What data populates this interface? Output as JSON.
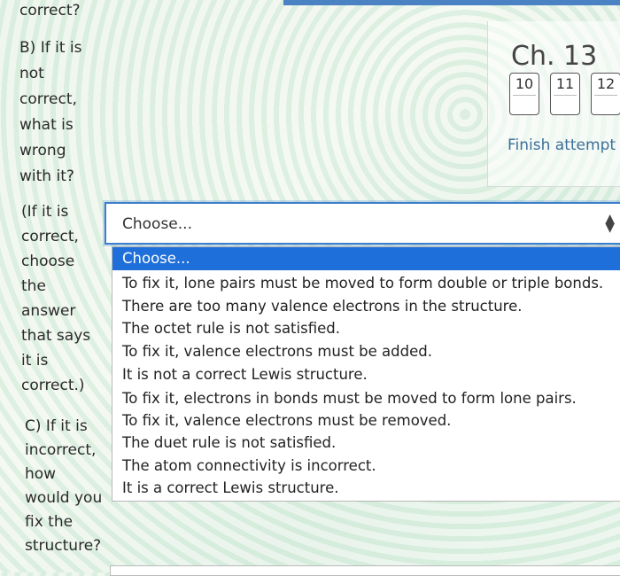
{
  "question": {
    "top_fragment": "correct?",
    "part_b_lines": [
      "B) If it is",
      "not",
      "correct,",
      "what is",
      "wrong",
      "with it?"
    ],
    "hint_lines": [
      "(If it is",
      "correct,",
      "choose",
      "the",
      "answer",
      "that says",
      "it is",
      "correct.)"
    ],
    "part_c_lines": [
      "C) If it is",
      "incorrect,",
      "how",
      "would you",
      "fix the",
      "structure?"
    ]
  },
  "navigation": {
    "chapter_title": "Ch. 13",
    "question_buttons": [
      "10",
      "11",
      "12"
    ],
    "finish_link": "Finish attempt ..."
  },
  "select": {
    "current_value": "Choose...",
    "options": [
      "Choose...",
      "To fix it, lone pairs must be moved to form double or triple bonds.",
      "There are too many valence electrons in the structure.",
      "The octet rule is not satisfied.",
      "To fix it, valence electrons must be added.",
      "It is not a correct Lewis structure.",
      "To fix it, electrons in bonds must be moved to form lone pairs.",
      "To fix it, valence electrons must be removed.",
      "The duet rule is not satisfied.",
      "The atom connectivity is incorrect.",
      "It is a correct Lewis structure."
    ],
    "selected_index": 0,
    "arrow_icon": "updown-arrows-icon"
  },
  "colors": {
    "accent": "#1e6fd9",
    "focus_border": "#3d7ecb",
    "link": "#3d6f99"
  }
}
